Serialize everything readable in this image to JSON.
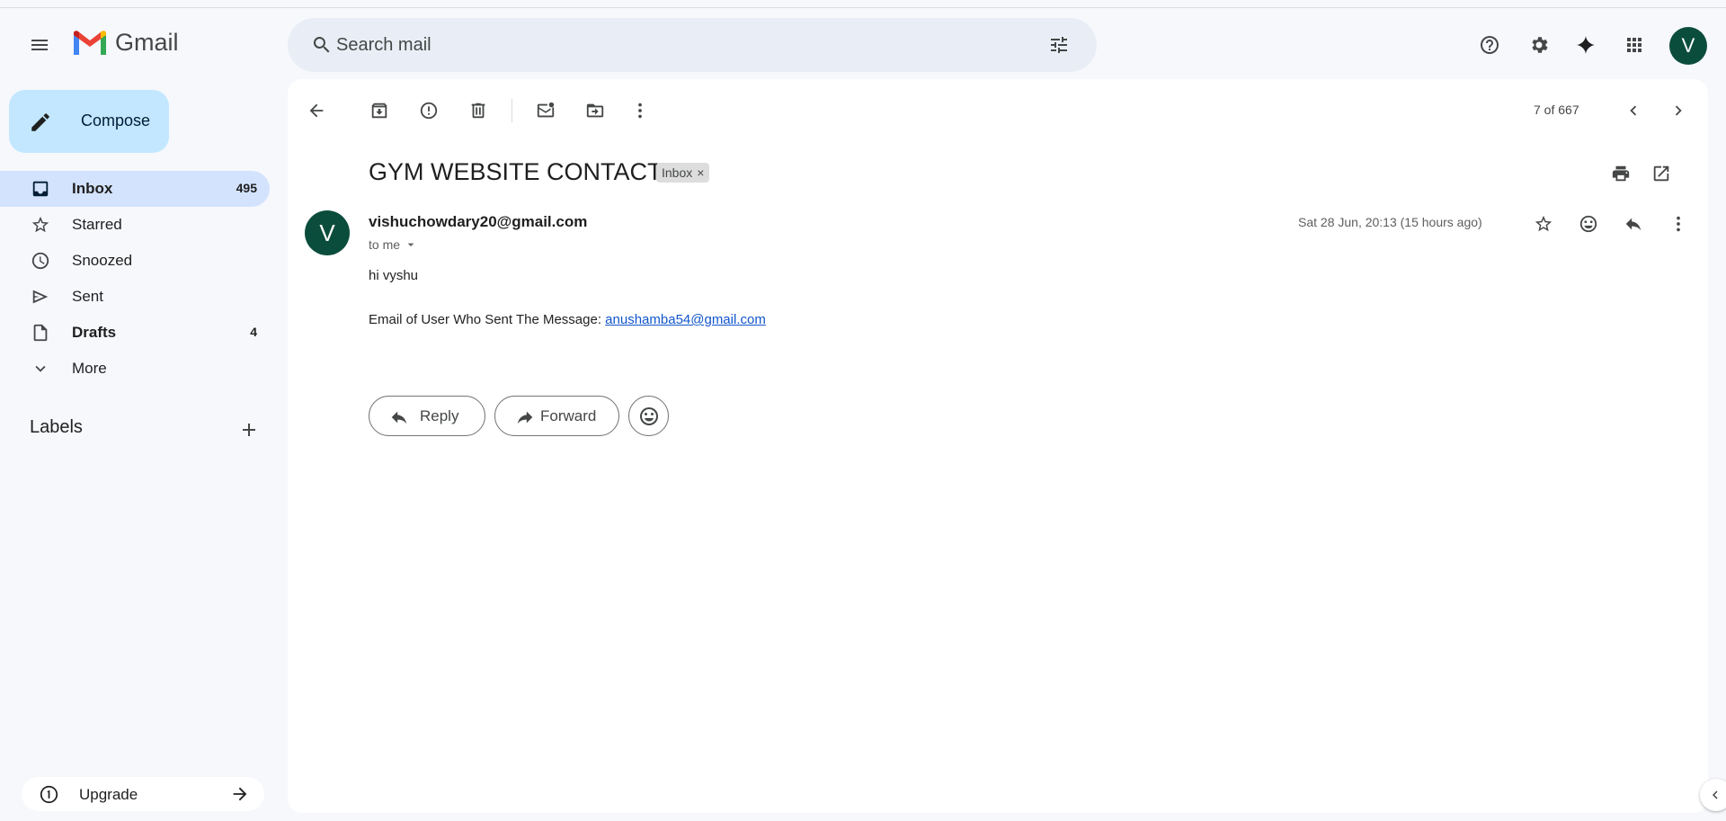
{
  "app": {
    "name": "Gmail",
    "user_initial": "V"
  },
  "search": {
    "placeholder": "Search mail"
  },
  "compose": {
    "label": "Compose"
  },
  "nav": [
    {
      "label": "Inbox",
      "count": "495"
    },
    {
      "label": "Starred",
      "count": ""
    },
    {
      "label": "Snoozed",
      "count": ""
    },
    {
      "label": "Sent",
      "count": ""
    },
    {
      "label": "Drafts",
      "count": "4"
    },
    {
      "label": "More",
      "count": ""
    }
  ],
  "labels": {
    "heading": "Labels"
  },
  "upgrade": {
    "label": "Upgrade"
  },
  "toolbar": {
    "pager": "7 of 667"
  },
  "message": {
    "subject": "GYM WEBSITE CONTACT",
    "chip": "Inbox",
    "sender_initial": "V",
    "sender": "vishuchowdary20@gmail.com",
    "recipient": "to me",
    "date": "Sat 28 Jun, 20:13 (15 hours ago)",
    "greeting": "hi vyshu",
    "email_prefix": "Email of User Who Sent The Message: ",
    "email_link": "anushamba54@gmail.com"
  },
  "actions": {
    "reply": "Reply",
    "forward": "Forward"
  },
  "colors": {
    "compose_bg": "#c2e7ff",
    "active_nav": "#d3e3fd",
    "avatar": "#0b4d3c",
    "link": "#1155cc",
    "background": "#f6f8fc"
  }
}
